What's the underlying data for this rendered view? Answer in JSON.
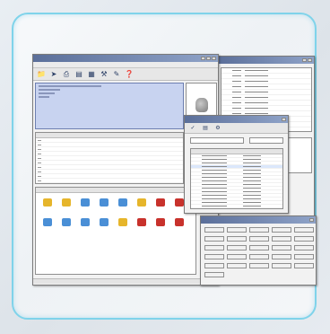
{
  "colors": {
    "frame_border": "#7fd3ea",
    "titlebar_start": "#5b6f9a",
    "titlebar_end": "#8fa3c8",
    "selection": "#dbe7fb",
    "icon_blue": "#4a8fd6",
    "icon_red": "#c8322c",
    "icon_yellow": "#e6b52b",
    "icon_green": "#4ea86b"
  },
  "main_window": {
    "toolbar_icons": [
      "folder-icon",
      "arrow-icon",
      "printer-icon",
      "chart-icon",
      "graph-icon",
      "tools-icon",
      "pen-icon",
      "help-icon"
    ]
  },
  "icons_panel": {
    "items": [
      {
        "name": "user-icon",
        "color": "#e6b52b"
      },
      {
        "name": "user-icon",
        "color": "#e6b52b"
      },
      {
        "name": "server-icon",
        "color": "#4a8fd6"
      },
      {
        "name": "server-icon",
        "color": "#4a8fd6"
      },
      {
        "name": "server-icon",
        "color": "#4a8fd6"
      },
      {
        "name": "globe-icon",
        "color": "#e6b52b"
      },
      {
        "name": "alert-icon",
        "color": "#c8322c"
      },
      {
        "name": "alert-icon",
        "color": "#c8322c"
      },
      {
        "name": "server-icon",
        "color": "#4a8fd6"
      },
      {
        "name": "server-icon",
        "color": "#4a8fd6"
      },
      {
        "name": "server-icon",
        "color": "#4a8fd6"
      },
      {
        "name": "server-icon",
        "color": "#4a8fd6"
      },
      {
        "name": "folder-icon",
        "color": "#e6b52b"
      },
      {
        "name": "alert-icon",
        "color": "#c8322c"
      },
      {
        "name": "alert-icon",
        "color": "#c8322c"
      },
      {
        "name": "alert-icon",
        "color": "#c8322c"
      }
    ]
  },
  "dialog": {
    "toolbar_icons": [
      "check-icon",
      "chart-icon",
      "gear-icon"
    ],
    "list_rows": 20
  },
  "keypad": {
    "rows": 6,
    "cols": 5
  }
}
